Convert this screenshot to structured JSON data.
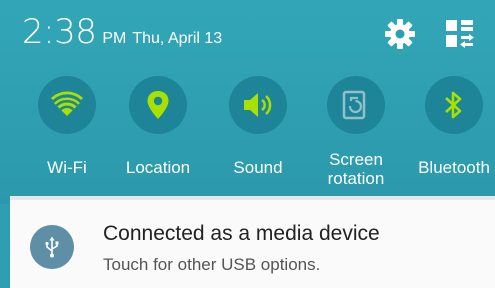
{
  "status_bar": {
    "time": "2:38",
    "ampm": "PM",
    "date": "Thu, April 13",
    "settings_icon": "gear-icon",
    "edit_icon": "quick-panel-edit-icon"
  },
  "quick_toggles": [
    {
      "label": "Wi-Fi",
      "icon": "wifi-icon"
    },
    {
      "label": "Location",
      "icon": "location-pin-icon"
    },
    {
      "label": "Sound",
      "icon": "sound-icon"
    },
    {
      "label": "Screen rotation",
      "icon": "screen-rotation-icon"
    },
    {
      "label": "Bluetooth",
      "icon": "bluetooth-icon"
    }
  ],
  "notification": {
    "icon": "usb-icon",
    "title": "Connected as a media device",
    "text": "Touch for other USB options."
  },
  "colors": {
    "panel": "#2e9fb0",
    "toggle_circle": "#1e8598",
    "toggle_active_icon": "#a8e000",
    "toggle_inactive_icon": "#8fc1cb",
    "notification_bg": "#fafafa",
    "usb_avatar": "#5e8fa6"
  }
}
